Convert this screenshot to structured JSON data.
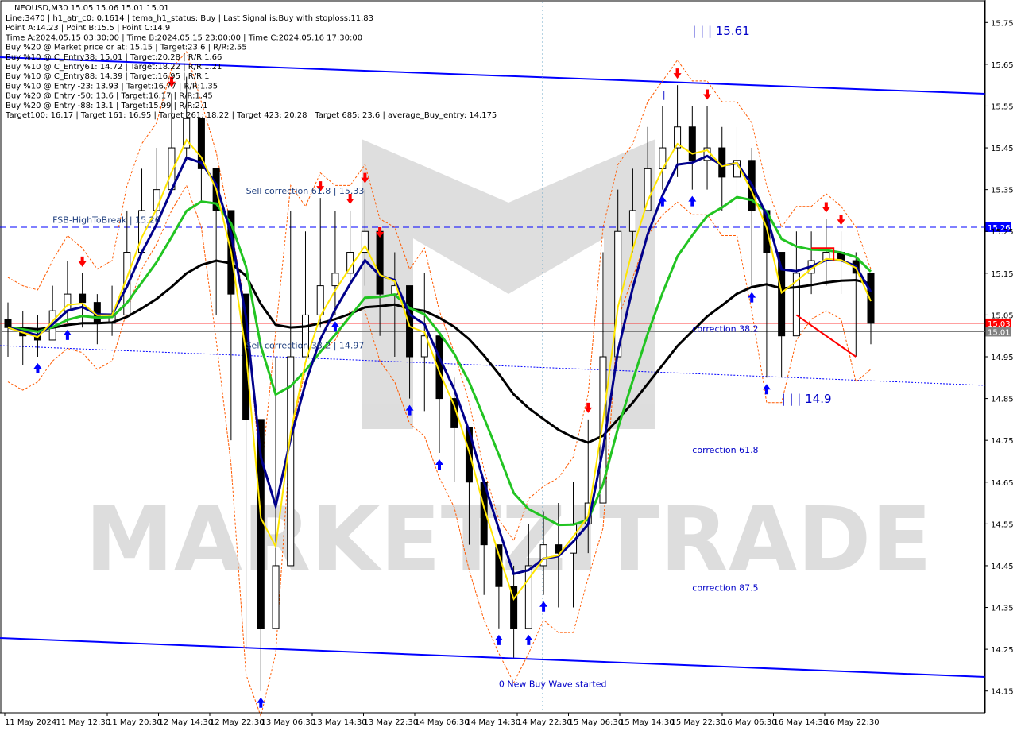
{
  "header": {
    "symbol_line": "NEOUSD,M30  15.05 15.06 15.01 15.01",
    "info_lines": [
      "Line:3470  |  h1_atr_c0: 0.1614  |  tema_h1_status: Buy  |  Last Signal is:Buy with stoploss:11.83",
      "Point A:14.23  |  Point B:15.5  |  Point C:14.9",
      "Time A:2024.05.15 03:30:00  |  Time B:2024.05.15 23:00:00  |  Time C:2024.05.16 17:30:00",
      "Buy %20 @ Market price or at: 15.15  |  Target:23.6  |  R/R:2.55",
      "Buy %10 @ C_Entry38: 15.01  |  Target:20.28  |  R/R:1.66",
      "Buy %10 @ C_Entry61: 14.72  |  Target:18.22  |  R/R:1.21",
      "Buy %10 @ C_Entry88: 14.39  |  Target:16.95  |  R/R:1",
      "Buy %10 @ Entry -23: 13.93  |  Target:16.77  |  R/R:1.35",
      "Buy %20 @ Entry -50: 13.6  |  Target:16.17  |  R/R:1.45",
      "Buy %20 @ Entry -88: 13.1  |  Target:15.99  |  R/R:2.1",
      "Target100: 16.17  |  Target 161: 16.95  |  Target 261: 18.22  |  Target 423: 20.28  |  Target 685: 23.6  |  average_Buy_entry: 14.175"
    ]
  },
  "watermark": "MARKETZITRADE",
  "chart_data": {
    "type": "candlestick",
    "symbol": "NEOUSD",
    "timeframe": "M30",
    "ylim": [
      14.1,
      15.8
    ],
    "y_ticks": [
      15.75,
      15.65,
      15.55,
      15.45,
      15.35,
      15.25,
      15.15,
      15.05,
      14.95,
      14.85,
      14.75,
      14.65,
      14.55,
      14.45,
      14.35,
      14.25,
      14.15
    ],
    "x_ticks": [
      "11 May 2024",
      "11 May 12:30",
      "11 May 20:30",
      "12 May 14:30",
      "12 May 22:30",
      "13 May 06:30",
      "13 May 14:30",
      "13 May 22:30",
      "14 May 06:30",
      "14 May 14:30",
      "14 May 22:30",
      "15 May 06:30",
      "15 May 14:30",
      "15 May 22:30",
      "16 May 06:30",
      "16 May 14:30",
      "16 May 22:30"
    ],
    "price_lines": [
      {
        "label": "15.26",
        "value": 15.26,
        "color": "#0000ff",
        "style": "dashed"
      },
      {
        "label": "15.03",
        "value": 15.03,
        "color": "#ff0000",
        "style": "solid"
      },
      {
        "label": "15.01",
        "value": 15.01,
        "color": "#808080",
        "style": "solid"
      }
    ],
    "annotations": [
      {
        "text": "| | | 15.61",
        "x_index": 46,
        "value": 15.72,
        "kind": "big"
      },
      {
        "text": "| | | 14.9",
        "x_index": 52,
        "value": 14.84,
        "kind": "big"
      },
      {
        "text": "Sell correction 61.8 | 15.33",
        "x_index": 16,
        "value": 15.34,
        "kind": "dark"
      },
      {
        "text": "Sell correction 38.2 | 14.97",
        "x_index": 16,
        "value": 14.97,
        "kind": "dark"
      },
      {
        "text": "FSB-HighToBreak | 15.26",
        "x_index": 3,
        "value": 15.27,
        "kind": "dark"
      },
      {
        "text": "correction 38.2",
        "x_index": 46,
        "value": 15.01,
        "kind": "normal"
      },
      {
        "text": "correction 61.8",
        "x_index": 46,
        "value": 14.72,
        "kind": "normal"
      },
      {
        "text": "correction 87.5",
        "x_index": 46,
        "value": 14.39,
        "kind": "normal"
      },
      {
        "text": "0 New Buy Wave started",
        "x_index": 33,
        "value": 14.16,
        "kind": "normal"
      },
      {
        "text": "|",
        "x_index": 44,
        "value": 15.57,
        "kind": "normal"
      }
    ],
    "close": [
      15.02,
      15.0,
      14.99,
      15.06,
      15.1,
      15.08,
      15.03,
      15.05,
      15.2,
      15.3,
      15.35,
      15.45,
      15.52,
      15.4,
      15.3,
      15.1,
      14.8,
      14.3,
      14.45,
      14.95,
      15.05,
      15.12,
      15.15,
      15.2,
      15.25,
      15.1,
      15.12,
      14.95,
      15.0,
      14.85,
      14.78,
      14.65,
      14.5,
      14.4,
      14.3,
      14.45,
      14.5,
      14.48,
      14.55,
      14.6,
      14.95,
      15.25,
      15.3,
      15.4,
      15.45,
      15.5,
      15.42,
      15.45,
      15.38,
      15.42,
      15.3,
      15.2,
      15.0,
      15.15,
      15.18,
      15.2,
      15.18,
      15.15,
      15.03
    ],
    "high": [
      15.08,
      15.06,
      15.05,
      15.12,
      15.18,
      15.15,
      15.1,
      15.12,
      15.3,
      15.4,
      15.45,
      15.58,
      15.62,
      15.5,
      15.38,
      15.2,
      15.0,
      14.6,
      14.95,
      15.3,
      15.25,
      15.33,
      15.3,
      15.3,
      15.35,
      15.22,
      15.2,
      15.1,
      15.15,
      15.0,
      14.9,
      14.78,
      14.62,
      14.5,
      14.45,
      14.55,
      14.58,
      14.6,
      14.65,
      14.8,
      15.2,
      15.35,
      15.4,
      15.5,
      15.55,
      15.6,
      15.55,
      15.55,
      15.5,
      15.5,
      15.45,
      15.3,
      15.2,
      15.25,
      15.25,
      15.28,
      15.25,
      15.2,
      15.1
    ],
    "low": [
      14.95,
      14.93,
      14.95,
      15.0,
      15.03,
      15.02,
      14.98,
      15.0,
      15.12,
      15.22,
      15.28,
      15.36,
      15.42,
      15.32,
      15.05,
      14.75,
      14.25,
      14.15,
      14.3,
      14.82,
      14.98,
      15.02,
      15.05,
      15.12,
      15.12,
      15.0,
      14.95,
      14.85,
      14.82,
      14.72,
      14.65,
      14.5,
      14.38,
      14.3,
      14.23,
      14.3,
      14.38,
      14.35,
      14.35,
      14.48,
      14.6,
      15.1,
      15.2,
      15.3,
      15.35,
      15.38,
      15.35,
      15.35,
      15.3,
      15.3,
      15.12,
      14.9,
      14.9,
      15.05,
      15.1,
      15.12,
      15.1,
      14.95,
      14.98
    ]
  }
}
